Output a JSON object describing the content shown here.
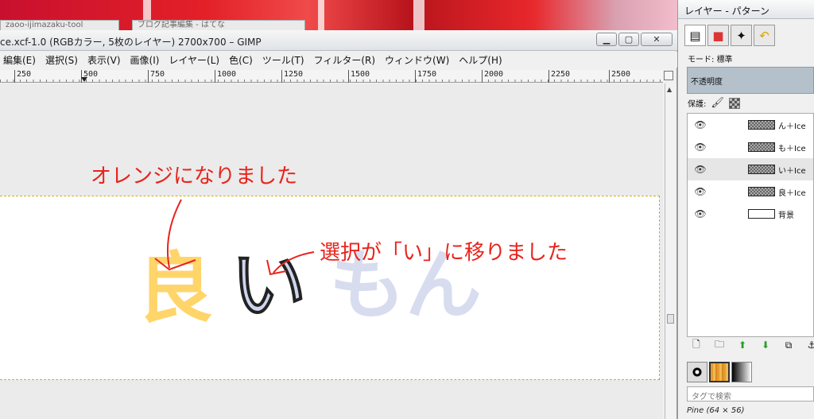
{
  "window": {
    "title": "ce.xcf-1.0 (RGBカラー, 5枚のレイヤー) 2700x700 – GIMP",
    "buttons": {
      "minimize": "▁",
      "maximize": "▢",
      "close": "✕"
    }
  },
  "background_tabs": [
    "zaoo-ijimazaku-tool",
    "ブログ記事編集 - はてな"
  ],
  "menu": [
    "編集(E)",
    "選択(S)",
    "表示(V)",
    "画像(I)",
    "レイヤー(L)",
    "色(C)",
    "ツール(T)",
    "フィルター(R)",
    "ウィンドウ(W)",
    "ヘルプ(H)"
  ],
  "ruler": [
    "250",
    "500",
    "750",
    "1000",
    "1250",
    "1500",
    "1750",
    "2000",
    "2250",
    "2500"
  ],
  "annotations": {
    "top": "オレンジになりました",
    "right": "選択が「い」に移りました"
  },
  "canvas_text": {
    "char1": "良",
    "char2": "い",
    "char3": "もん"
  },
  "colors": {
    "orange": "#ffd56a",
    "lavender": "#cfd5ec",
    "annotation_red": "#e8231c",
    "selection": "#c9b400"
  },
  "dock": {
    "title": "レイヤー - パターン",
    "mode_label": "モード:",
    "mode_value": "標準",
    "opacity_label": "不透明度",
    "lock_label": "保護:",
    "layers": [
      {
        "name": "ん＋Ice",
        "visible": true,
        "active": false
      },
      {
        "name": "も＋Ice",
        "visible": true,
        "active": false
      },
      {
        "name": "い＋Ice",
        "visible": true,
        "active": true
      },
      {
        "name": "良＋Ice",
        "visible": true,
        "active": false
      },
      {
        "name": "背景",
        "visible": true,
        "active": false
      }
    ],
    "tag_search_placeholder": "タグで検索",
    "pattern_name": "Pine (64 × 56)"
  }
}
